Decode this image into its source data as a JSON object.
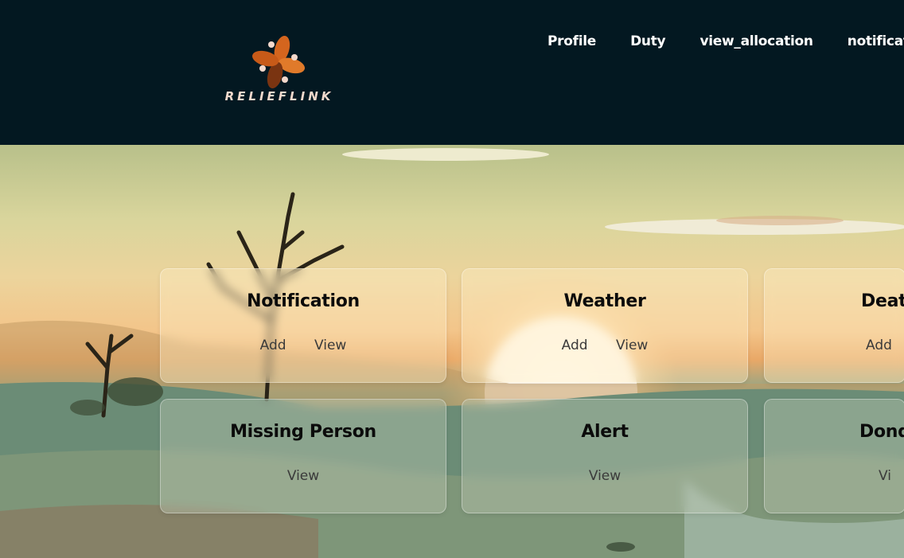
{
  "header": {
    "brand": "RELIEFLINK",
    "nav": [
      "Profile",
      "Duty",
      "view_allocation",
      "notificatio"
    ]
  },
  "cards": [
    {
      "title": "Notification",
      "actions": [
        "Add",
        "View"
      ]
    },
    {
      "title": "Weather",
      "actions": [
        "Add",
        "View"
      ]
    },
    {
      "title": "Deat",
      "actions": [
        "Add"
      ]
    },
    {
      "title": "Missing Person",
      "actions": [
        "View"
      ]
    },
    {
      "title": "Alert",
      "actions": [
        "View"
      ]
    },
    {
      "title": "Dond",
      "actions": [
        "Vi"
      ]
    }
  ],
  "colors": {
    "topbar": "#031821",
    "nav_text": "#ffffff",
    "logo_orange": "#d4651e",
    "logo_brown": "#7a3411"
  },
  "icons": {
    "logo": "flower-pinwheel-logo"
  }
}
